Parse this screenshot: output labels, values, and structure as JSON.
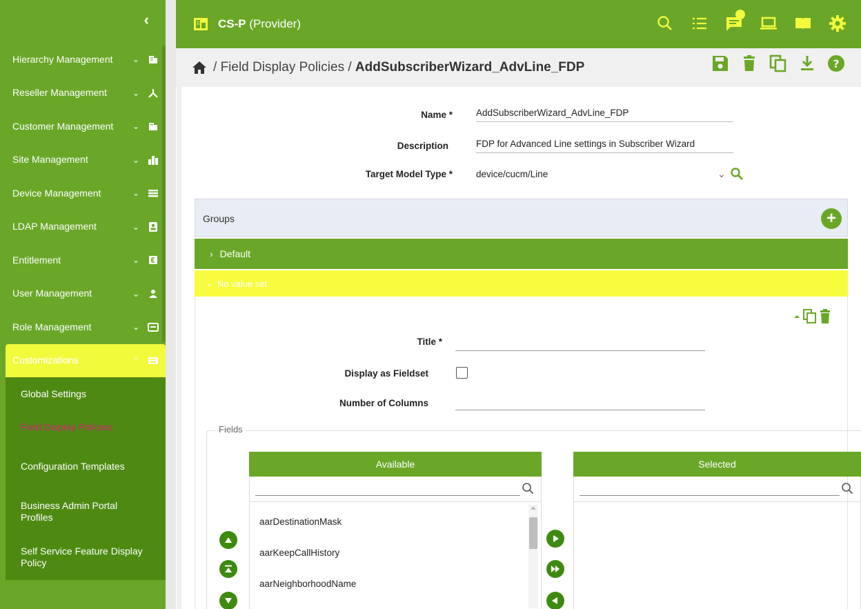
{
  "app": {
    "org_name": "CS-P",
    "org_role": "(Provider)",
    "notification_indicator_color": "#f2fa3c",
    "accent_color": "#6aa728",
    "highlight_color": "#f2fa3c"
  },
  "sidebar": {
    "collapse_label": "‹",
    "items": [
      {
        "label": "Hierarchy Management",
        "icon": "building-icon"
      },
      {
        "label": "Reseller Management",
        "icon": "hierarchy-icon"
      },
      {
        "label": "Customer Management",
        "icon": "building-icon"
      },
      {
        "label": "Site Management",
        "icon": "city-icon"
      },
      {
        "label": "Device Management",
        "icon": "list-icon"
      },
      {
        "label": "LDAP Management",
        "icon": "contact-card-icon"
      },
      {
        "label": "Entitlement",
        "icon": "entitlement-icon"
      },
      {
        "label": "User Management",
        "icon": "user-icon"
      },
      {
        "label": "Role Management",
        "icon": "id-card-icon"
      },
      {
        "label": "Customizations",
        "icon": "keyboard-icon",
        "active": true
      }
    ],
    "sub_items": [
      {
        "label": "Global Settings"
      },
      {
        "label": "Field Display Policies",
        "current": true
      },
      {
        "label": "Configuration Templates"
      },
      {
        "label": "Business Admin Portal Profiles"
      },
      {
        "label": "Self Service Feature Display Policy"
      }
    ]
  },
  "breadcrumb": {
    "separator": "/",
    "section": "Field Display Policies",
    "current": "AddSubscriberWizard_AdvLine_FDP"
  },
  "form": {
    "name_label": "Name *",
    "name_value": "AddSubscriberWizard_AdvLine_FDP",
    "description_label": "Description",
    "description_value": "FDP for Advanced Line settings in Subscriber Wizard",
    "target_label": "Target Model Type *",
    "target_value": "device/cucm/Line"
  },
  "groups": {
    "label": "Groups",
    "add_label": "+",
    "default_label": "Default",
    "novalue_label": "No value set",
    "title_label": "Title *",
    "title_value": "",
    "fieldset_label": "Display as Fieldset",
    "fieldset_checked": false,
    "columns_label": "Number of Columns",
    "columns_value": ""
  },
  "fields": {
    "legend": "Fields",
    "available_header": "Available",
    "selected_header": "Selected",
    "available_search": "",
    "selected_search": "",
    "available_items": [
      "aarDestinationMask",
      "aarKeepCallHistory",
      "aarNeighborhoodName"
    ],
    "selected_items": []
  }
}
